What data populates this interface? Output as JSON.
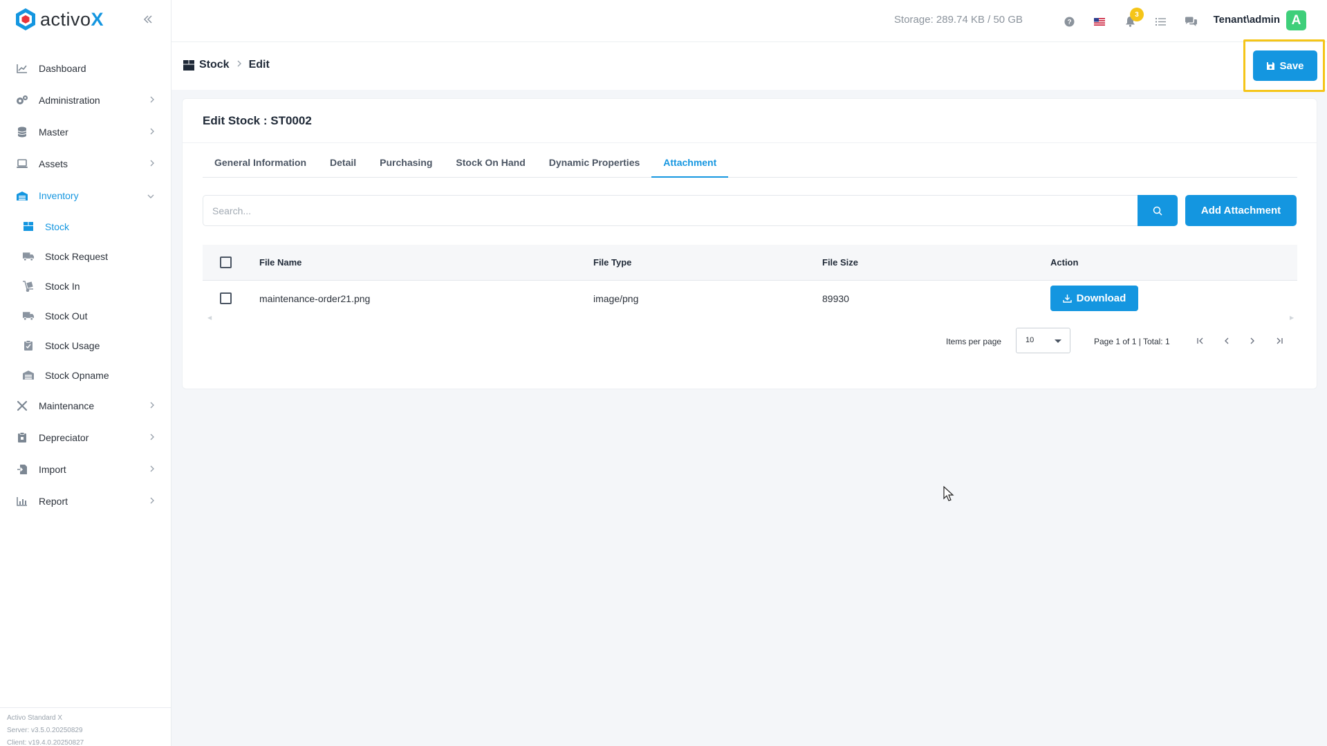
{
  "app": {
    "logo_text": "activo",
    "logo_accent": "X",
    "brand_color": "#1496e0"
  },
  "sidebar": {
    "items": [
      {
        "label": "Dashboard",
        "icon": "chart-line-icon"
      },
      {
        "label": "Administration",
        "icon": "gears-icon"
      },
      {
        "label": "Master",
        "icon": "database-icon"
      },
      {
        "label": "Assets",
        "icon": "laptop-icon"
      },
      {
        "label": "Inventory",
        "icon": "warehouse-icon"
      },
      {
        "label": "Maintenance",
        "icon": "tools-icon"
      },
      {
        "label": "Depreciator",
        "icon": "clipboard-icon"
      },
      {
        "label": "Import",
        "icon": "file-import-icon"
      },
      {
        "label": "Report",
        "icon": "chart-bar-icon"
      }
    ],
    "inventory_sub": [
      {
        "label": "Stock",
        "icon": "box-icon"
      },
      {
        "label": "Stock Request",
        "icon": "truck-icon"
      },
      {
        "label": "Stock In",
        "icon": "dolly-icon"
      },
      {
        "label": "Stock Out",
        "icon": "truck-out-icon"
      },
      {
        "label": "Stock Usage",
        "icon": "clipboard-check-icon"
      },
      {
        "label": "Stock Opname",
        "icon": "warehouse-icon"
      }
    ],
    "version": {
      "product": "Activo Standard X",
      "server": "Server: v3.5.0.20250829",
      "client": "Client: v19.4.0.20250827"
    }
  },
  "topbar": {
    "storage": "Storage: 289.74 KB / 50 GB",
    "notification_count": "3",
    "user": "Tenant\\admin",
    "avatar_letter": "A"
  },
  "header": {
    "breadcrumb_root": "Stock",
    "breadcrumb_current": "Edit",
    "save_label": "Save"
  },
  "card": {
    "title": "Edit Stock : ST0002",
    "tabs": [
      "General Information",
      "Detail",
      "Purchasing",
      "Stock On Hand",
      "Dynamic Properties",
      "Attachment"
    ],
    "active_tab": "Attachment",
    "search_placeholder": "Search...",
    "add_label": "Add Attachment"
  },
  "table": {
    "columns": [
      "File Name",
      "File Type",
      "File Size",
      "Action"
    ],
    "rows": [
      {
        "file_name": "maintenance-order21.png",
        "file_type": "image/png",
        "file_size": "89930",
        "action": "Download"
      }
    ]
  },
  "paginator": {
    "items_label": "Items per page",
    "page_size": "10",
    "info": "Page 1 of 1 | Total: 1"
  }
}
